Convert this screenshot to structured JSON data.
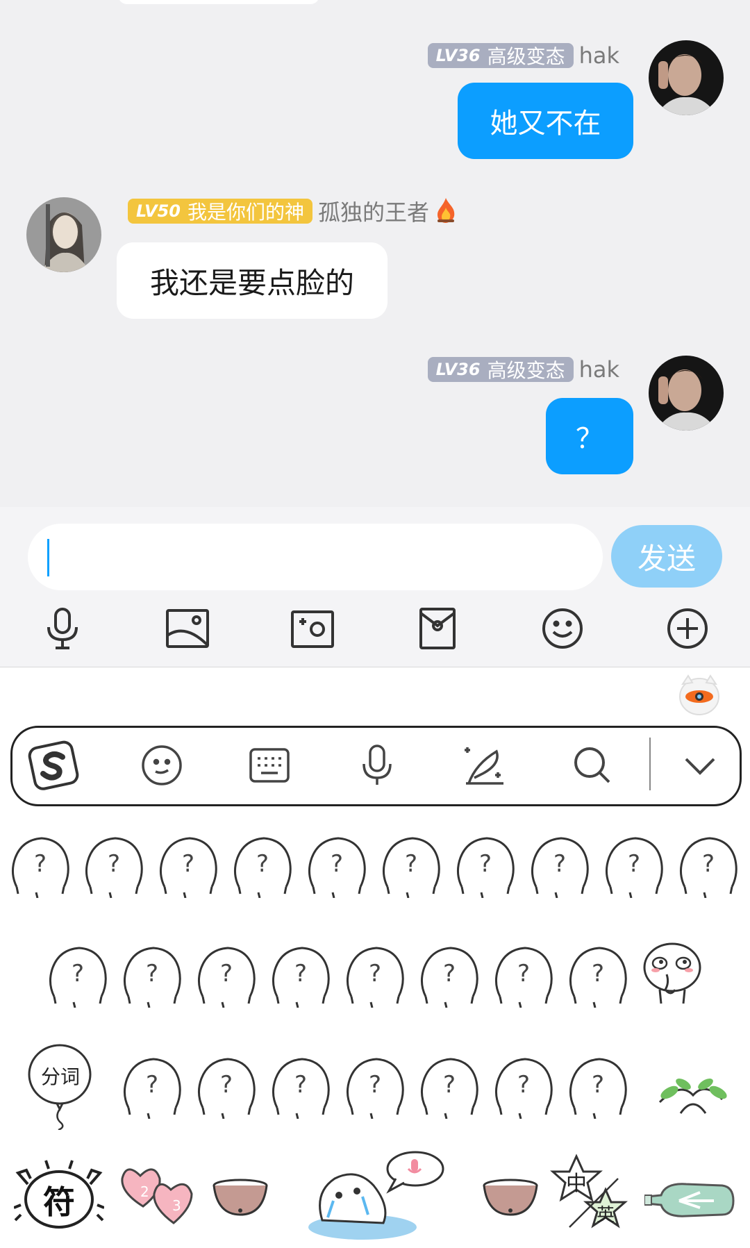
{
  "messages": [
    {
      "side": "right",
      "level": "LV36",
      "title": "高级变态",
      "name": "hak",
      "text": "她又不在"
    },
    {
      "side": "left",
      "level": "LV50",
      "title": "我是你们的神",
      "name": "孤独的王者",
      "text": "我还是要点脸的"
    },
    {
      "side": "right",
      "level": "LV36",
      "title": "高级变态",
      "name": "hak",
      "text": "？"
    }
  ],
  "input": {
    "value": "",
    "send_label": "发送"
  },
  "toolbar_icons": [
    "microphone-icon",
    "image-icon",
    "camera-icon",
    "red-packet-icon",
    "emoji-icon",
    "plus-icon"
  ],
  "keyboard": {
    "top_icons": [
      "sogou-logo-icon",
      "emoji-icon",
      "keyboard-icon",
      "voice-icon",
      "handwriting-icon",
      "search-icon",
      "collapse-icon"
    ],
    "sticker_labels": {
      "fenci": "分词",
      "fu": "符",
      "zh": "中",
      "en": "英"
    }
  },
  "colors": {
    "bubble_blue": "#0c9eff",
    "send_button": "#8fd0f8",
    "badge_gray": "#a9aec0",
    "badge_gold": "#f3c53e",
    "caret": "#0aa0ff"
  }
}
